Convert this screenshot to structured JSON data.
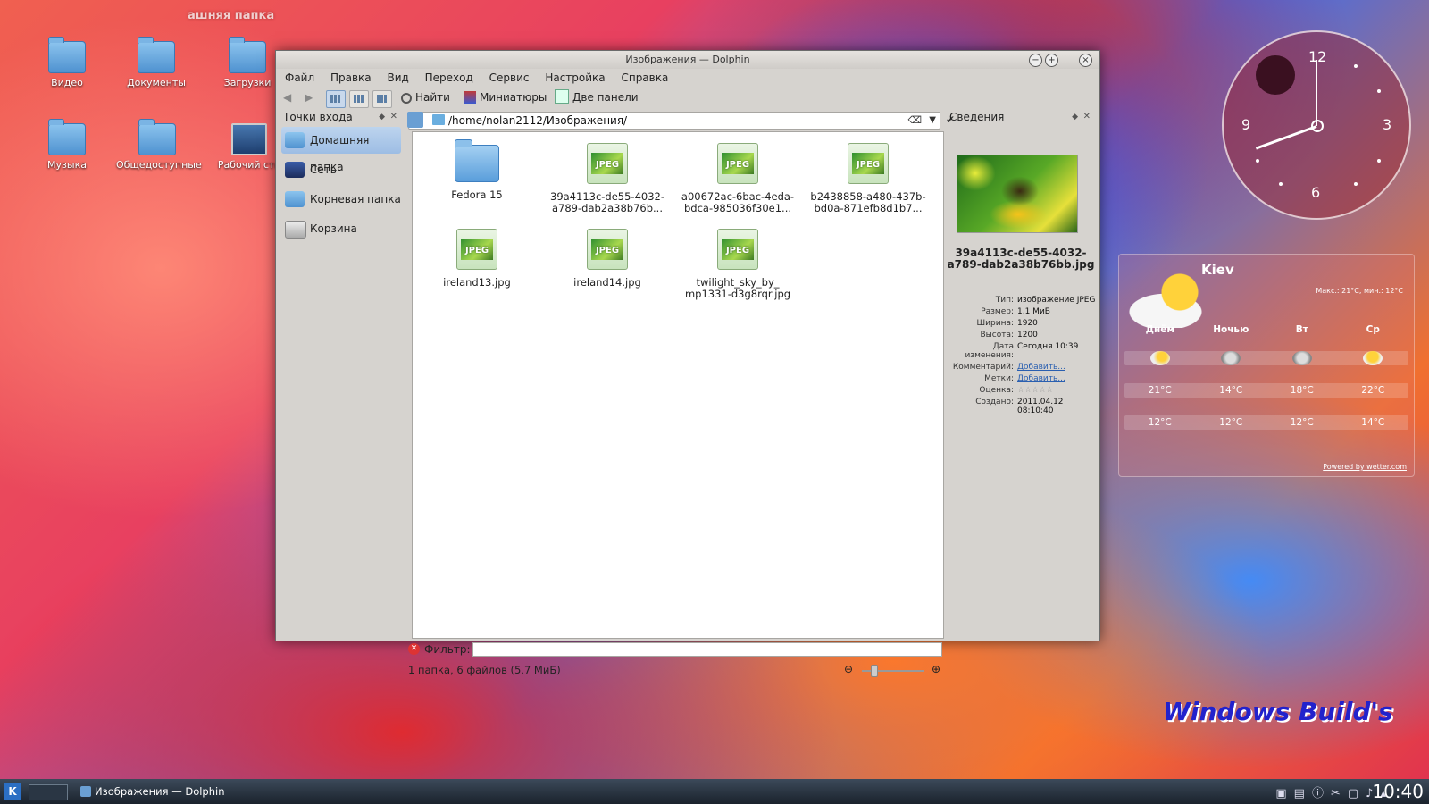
{
  "desktop": {
    "top_label": "ашняя папка",
    "icons": [
      {
        "label": "Видео"
      },
      {
        "label": "Документы"
      },
      {
        "label": "Загрузки"
      },
      {
        "label": "Музыка"
      },
      {
        "label": "Общедоступные"
      },
      {
        "label": "Рабочий сто"
      }
    ],
    "brand": "Windows Build's"
  },
  "window": {
    "title": "Изображения — Dolphin",
    "menu": [
      "Файл",
      "Правка",
      "Вид",
      "Переход",
      "Сервис",
      "Настройка",
      "Справка"
    ],
    "toolbar": {
      "find": "Найти",
      "thumbnails": "Миниатюры",
      "split": "Две панели"
    },
    "places": {
      "title": "Точки входа",
      "items": [
        {
          "label": "Домашняя папка",
          "active": true
        },
        {
          "label": "Сеть"
        },
        {
          "label": "Корневая папка"
        },
        {
          "label": "Корзина"
        }
      ]
    },
    "path": "/home/nolan2112/Изображения/",
    "files": [
      {
        "name": "Fedora 15",
        "kind": "folder-icon"
      },
      {
        "name": "39a4113c-de55-4032-a789-dab2a38b76b...",
        "kind": "jpeg-icon"
      },
      {
        "name": "a00672ac-6bac-4eda-bdca-985036f30e1...",
        "kind": "jpeg-icon"
      },
      {
        "name": "b2438858-a480-437b-bd0a-871efb8d1b7...",
        "kind": "jpeg-icon"
      },
      {
        "name": "ireland13.jpg",
        "kind": "jpeg-icon"
      },
      {
        "name": "ireland14.jpg",
        "kind": "jpeg-icon"
      },
      {
        "name": "twilight_sky_by_ mp1331-d3g8rqr.jpg",
        "kind": "jpeg-icon"
      }
    ],
    "jpeg_badge": "JPEG",
    "filter_label": "Фильтр:",
    "status": "1 папка, 6 файлов (5,7 МиБ)",
    "info": {
      "title": "Сведения",
      "filename": "39a4113c-de55-4032-a789-dab2a38b76bb.jpg",
      "rows": [
        {
          "k": "Тип:",
          "v": "изображение JPEG"
        },
        {
          "k": "Размер:",
          "v": "1,1 МиБ"
        },
        {
          "k": "Ширина:",
          "v": "1920"
        },
        {
          "k": "Высота:",
          "v": "1200"
        },
        {
          "k": "Дата изменения:",
          "v": "Сегодня 10:39"
        },
        {
          "k": "Комментарий:",
          "v": "Добавить...",
          "link": true
        },
        {
          "k": "Метки:",
          "v": "Добавить...",
          "link": true
        },
        {
          "k": "Оценка:",
          "v": "☆☆☆☆☆"
        },
        {
          "k": "Создано:",
          "v": "2011.04.12 08:10:40"
        }
      ]
    }
  },
  "clock_widget": {
    "n12": "12",
    "n3": "3",
    "n6": "6",
    "n9": "9"
  },
  "weather": {
    "city": "Kiev",
    "maxmin": "Макс.: 21°C, мин.: 12°C",
    "periods": [
      "Днём",
      "Ночью",
      "Вт",
      "Ср"
    ],
    "highs": [
      "21°C",
      "14°C",
      "18°C",
      "22°C"
    ],
    "lows": [
      "12°C",
      "12°C",
      "12°C",
      "14°C"
    ],
    "powered": "Powered by wetter.com"
  },
  "taskbar": {
    "task": "Изображения — Dolphin",
    "time": "10:40"
  }
}
